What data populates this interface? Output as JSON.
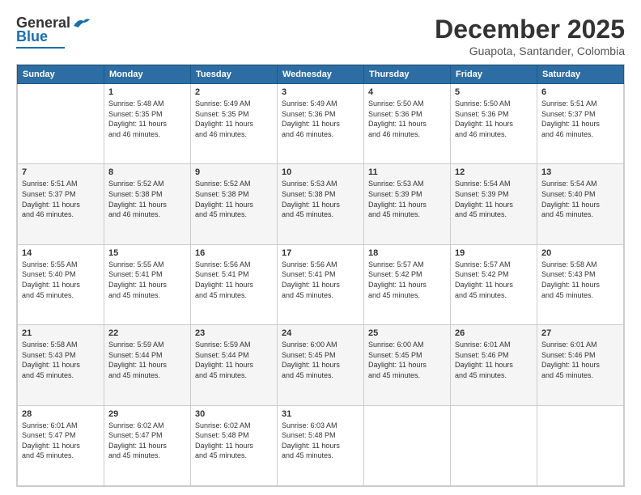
{
  "logo": {
    "line1": "General",
    "line2": "Blue"
  },
  "title": "December 2025",
  "subtitle": "Guapota, Santander, Colombia",
  "days_header": [
    "Sunday",
    "Monday",
    "Tuesday",
    "Wednesday",
    "Thursday",
    "Friday",
    "Saturday"
  ],
  "weeks": [
    [
      {
        "day": "",
        "info": ""
      },
      {
        "day": "1",
        "info": "Sunrise: 5:48 AM\nSunset: 5:35 PM\nDaylight: 11 hours\nand 46 minutes."
      },
      {
        "day": "2",
        "info": "Sunrise: 5:49 AM\nSunset: 5:35 PM\nDaylight: 11 hours\nand 46 minutes."
      },
      {
        "day": "3",
        "info": "Sunrise: 5:49 AM\nSunset: 5:36 PM\nDaylight: 11 hours\nand 46 minutes."
      },
      {
        "day": "4",
        "info": "Sunrise: 5:50 AM\nSunset: 5:36 PM\nDaylight: 11 hours\nand 46 minutes."
      },
      {
        "day": "5",
        "info": "Sunrise: 5:50 AM\nSunset: 5:36 PM\nDaylight: 11 hours\nand 46 minutes."
      },
      {
        "day": "6",
        "info": "Sunrise: 5:51 AM\nSunset: 5:37 PM\nDaylight: 11 hours\nand 46 minutes."
      }
    ],
    [
      {
        "day": "7",
        "info": "Sunrise: 5:51 AM\nSunset: 5:37 PM\nDaylight: 11 hours\nand 46 minutes."
      },
      {
        "day": "8",
        "info": "Sunrise: 5:52 AM\nSunset: 5:38 PM\nDaylight: 11 hours\nand 46 minutes."
      },
      {
        "day": "9",
        "info": "Sunrise: 5:52 AM\nSunset: 5:38 PM\nDaylight: 11 hours\nand 45 minutes."
      },
      {
        "day": "10",
        "info": "Sunrise: 5:53 AM\nSunset: 5:38 PM\nDaylight: 11 hours\nand 45 minutes."
      },
      {
        "day": "11",
        "info": "Sunrise: 5:53 AM\nSunset: 5:39 PM\nDaylight: 11 hours\nand 45 minutes."
      },
      {
        "day": "12",
        "info": "Sunrise: 5:54 AM\nSunset: 5:39 PM\nDaylight: 11 hours\nand 45 minutes."
      },
      {
        "day": "13",
        "info": "Sunrise: 5:54 AM\nSunset: 5:40 PM\nDaylight: 11 hours\nand 45 minutes."
      }
    ],
    [
      {
        "day": "14",
        "info": "Sunrise: 5:55 AM\nSunset: 5:40 PM\nDaylight: 11 hours\nand 45 minutes."
      },
      {
        "day": "15",
        "info": "Sunrise: 5:55 AM\nSunset: 5:41 PM\nDaylight: 11 hours\nand 45 minutes."
      },
      {
        "day": "16",
        "info": "Sunrise: 5:56 AM\nSunset: 5:41 PM\nDaylight: 11 hours\nand 45 minutes."
      },
      {
        "day": "17",
        "info": "Sunrise: 5:56 AM\nSunset: 5:41 PM\nDaylight: 11 hours\nand 45 minutes."
      },
      {
        "day": "18",
        "info": "Sunrise: 5:57 AM\nSunset: 5:42 PM\nDaylight: 11 hours\nand 45 minutes."
      },
      {
        "day": "19",
        "info": "Sunrise: 5:57 AM\nSunset: 5:42 PM\nDaylight: 11 hours\nand 45 minutes."
      },
      {
        "day": "20",
        "info": "Sunrise: 5:58 AM\nSunset: 5:43 PM\nDaylight: 11 hours\nand 45 minutes."
      }
    ],
    [
      {
        "day": "21",
        "info": "Sunrise: 5:58 AM\nSunset: 5:43 PM\nDaylight: 11 hours\nand 45 minutes."
      },
      {
        "day": "22",
        "info": "Sunrise: 5:59 AM\nSunset: 5:44 PM\nDaylight: 11 hours\nand 45 minutes."
      },
      {
        "day": "23",
        "info": "Sunrise: 5:59 AM\nSunset: 5:44 PM\nDaylight: 11 hours\nand 45 minutes."
      },
      {
        "day": "24",
        "info": "Sunrise: 6:00 AM\nSunset: 5:45 PM\nDaylight: 11 hours\nand 45 minutes."
      },
      {
        "day": "25",
        "info": "Sunrise: 6:00 AM\nSunset: 5:45 PM\nDaylight: 11 hours\nand 45 minutes."
      },
      {
        "day": "26",
        "info": "Sunrise: 6:01 AM\nSunset: 5:46 PM\nDaylight: 11 hours\nand 45 minutes."
      },
      {
        "day": "27",
        "info": "Sunrise: 6:01 AM\nSunset: 5:46 PM\nDaylight: 11 hours\nand 45 minutes."
      }
    ],
    [
      {
        "day": "28",
        "info": "Sunrise: 6:01 AM\nSunset: 5:47 PM\nDaylight: 11 hours\nand 45 minutes."
      },
      {
        "day": "29",
        "info": "Sunrise: 6:02 AM\nSunset: 5:47 PM\nDaylight: 11 hours\nand 45 minutes."
      },
      {
        "day": "30",
        "info": "Sunrise: 6:02 AM\nSunset: 5:48 PM\nDaylight: 11 hours\nand 45 minutes."
      },
      {
        "day": "31",
        "info": "Sunrise: 6:03 AM\nSunset: 5:48 PM\nDaylight: 11 hours\nand 45 minutes."
      },
      {
        "day": "",
        "info": ""
      },
      {
        "day": "",
        "info": ""
      },
      {
        "day": "",
        "info": ""
      }
    ]
  ]
}
